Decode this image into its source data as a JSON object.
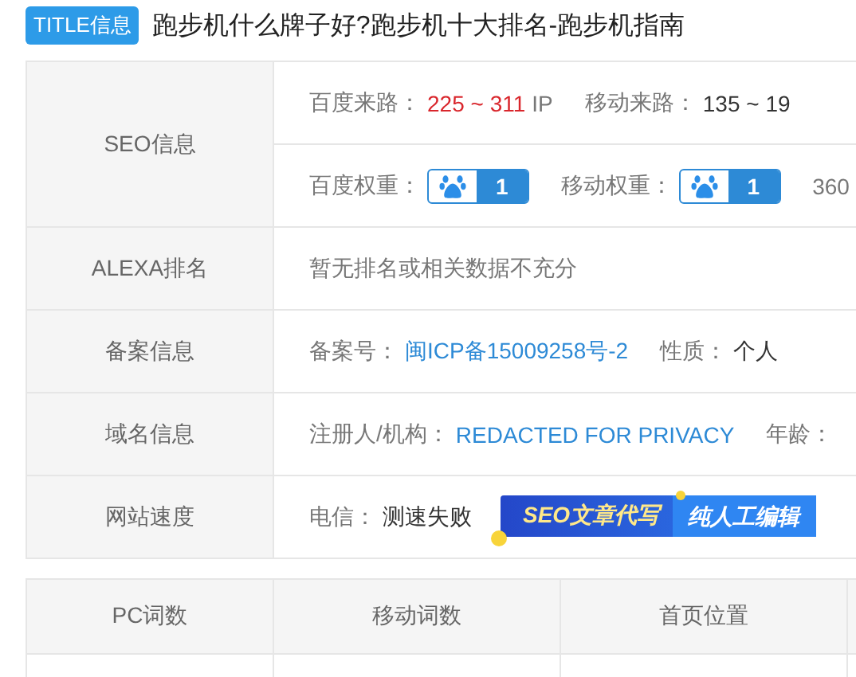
{
  "title": {
    "badge": "TITLE信息",
    "text": "跑步机什么牌子好?跑步机十大排名-跑步机指南"
  },
  "info_rows": [
    {
      "label": "SEO信息",
      "lines": [
        [
          {
            "kind": "red",
            "label": "百度来路：",
            "value": "225 ~ 311",
            "unit": "IP"
          },
          {
            "kind": "plain",
            "label": "移动来路：",
            "value": "135 ~ 19"
          }
        ],
        [
          {
            "kind": "weight",
            "label": "百度权重：",
            "value": "1"
          },
          {
            "kind": "weight",
            "label": "移动权重：",
            "value": "1"
          },
          {
            "kind": "cut",
            "label": "360"
          }
        ]
      ]
    },
    {
      "label": "ALEXA排名",
      "lines": [
        [
          {
            "kind": "note",
            "label": "暂无排名或相关数据不充分"
          }
        ]
      ]
    },
    {
      "label": "备案信息",
      "lines": [
        [
          {
            "kind": "link",
            "label": "备案号：",
            "value": "闽ICP备15009258号-2"
          },
          {
            "kind": "plain",
            "label": "性质：",
            "value": "个人"
          }
        ]
      ]
    },
    {
      "label": "域名信息",
      "lines": [
        [
          {
            "kind": "link",
            "label": "注册人/机构：",
            "value": "REDACTED FOR PRIVACY"
          },
          {
            "kind": "cut",
            "label": "年龄："
          }
        ]
      ]
    },
    {
      "label": "网站速度",
      "lines": [
        [
          {
            "kind": "plain",
            "label": "电信：",
            "value": "测速失败"
          },
          {
            "kind": "ad",
            "label": "SEO文章代写",
            "value": "纯人工编辑"
          }
        ]
      ]
    }
  ],
  "word_table": {
    "columns": [
      "PC词数",
      "移动词数",
      "首页位置"
    ]
  }
}
